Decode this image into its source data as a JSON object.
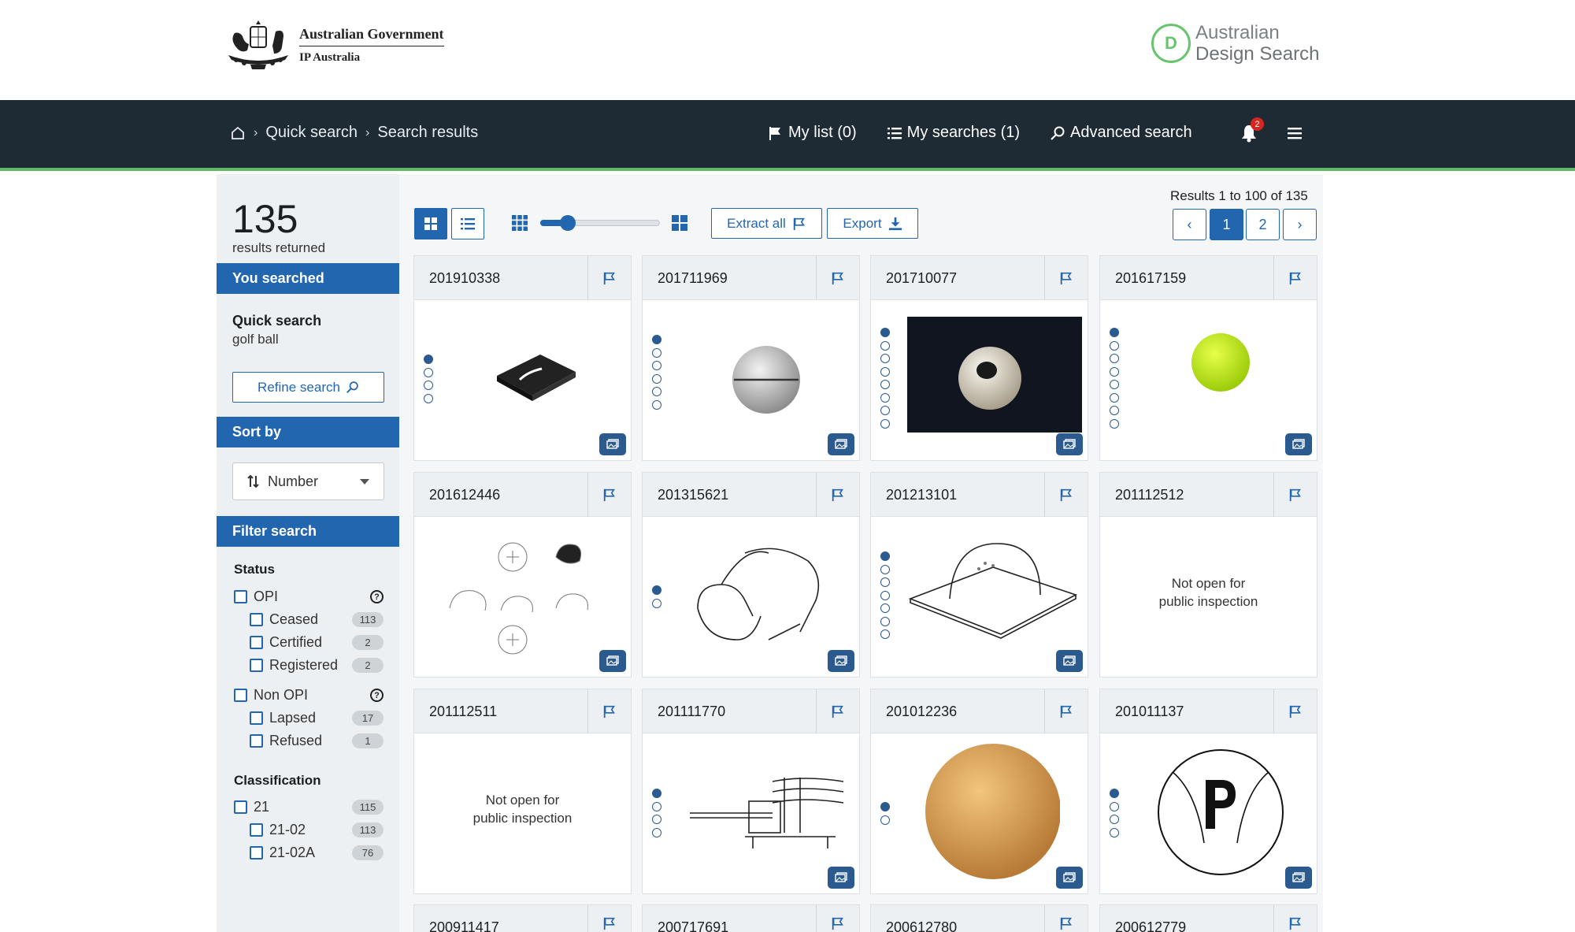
{
  "header": {
    "gov_line1": "Australian Government",
    "gov_line2": "IP Australia",
    "ads_letter": "D",
    "ads_line1": "Australian",
    "ads_line2": "Design Search"
  },
  "nav": {
    "breadcrumb": [
      "Quick search",
      "Search results"
    ],
    "my_list": "My list (0)",
    "my_searches": "My searches (1)",
    "advanced_search": "Advanced search",
    "notification_count": "2"
  },
  "sidebar": {
    "count": "135",
    "count_label": "results returned",
    "you_searched": "You searched",
    "quick_search_title": "Quick search",
    "quick_search_value": "golf ball",
    "refine_label": "Refine search",
    "sort_by": "Sort by",
    "sort_value": "Number",
    "filter_search": "Filter search",
    "status_title": "Status",
    "opi": "OPI",
    "ceased": "Ceased",
    "ceased_count": "113",
    "certified": "Certified",
    "certified_count": "2",
    "registered": "Registered",
    "registered_count": "2",
    "non_opi": "Non OPI",
    "lapsed": "Lapsed",
    "lapsed_count": "17",
    "refused": "Refused",
    "refused_count": "1",
    "classification_title": "Classification",
    "c21": "21",
    "c21_count": "115",
    "c2102": "21-02",
    "c2102_count": "113",
    "c2102a": "21-02A",
    "c2102a_count": "76",
    "help_glyph": "?"
  },
  "toolbar": {
    "extract_all": "Extract all",
    "export": "Export",
    "results_info": "Results 1 to 100 of 135",
    "pages": [
      "‹",
      "1",
      "2",
      "›"
    ]
  },
  "cards": [
    {
      "number": "201910338",
      "not_open": ""
    },
    {
      "number": "201711969",
      "not_open": ""
    },
    {
      "number": "201710077",
      "not_open": ""
    },
    {
      "number": "201617159",
      "not_open": ""
    },
    {
      "number": "201612446",
      "not_open": ""
    },
    {
      "number": "201315621",
      "not_open": ""
    },
    {
      "number": "201213101",
      "not_open": ""
    },
    {
      "number": "201112512",
      "not_open": "Not open for public inspection"
    },
    {
      "number": "201112511",
      "not_open": "Not open for public inspection"
    },
    {
      "number": "201111770",
      "not_open": ""
    },
    {
      "number": "201012236",
      "not_open": ""
    },
    {
      "number": "201011137",
      "not_open": ""
    },
    {
      "number": "200911417",
      "not_open": ""
    },
    {
      "number": "200717691",
      "not_open": ""
    },
    {
      "number": "200612780",
      "not_open": ""
    },
    {
      "number": "200612779",
      "not_open": ""
    }
  ],
  "colors": {
    "nav_bg": "#1e2a34",
    "accent_blue": "#2366b0",
    "accent_green": "#5dbb63",
    "notification_red": "#d7261d"
  }
}
